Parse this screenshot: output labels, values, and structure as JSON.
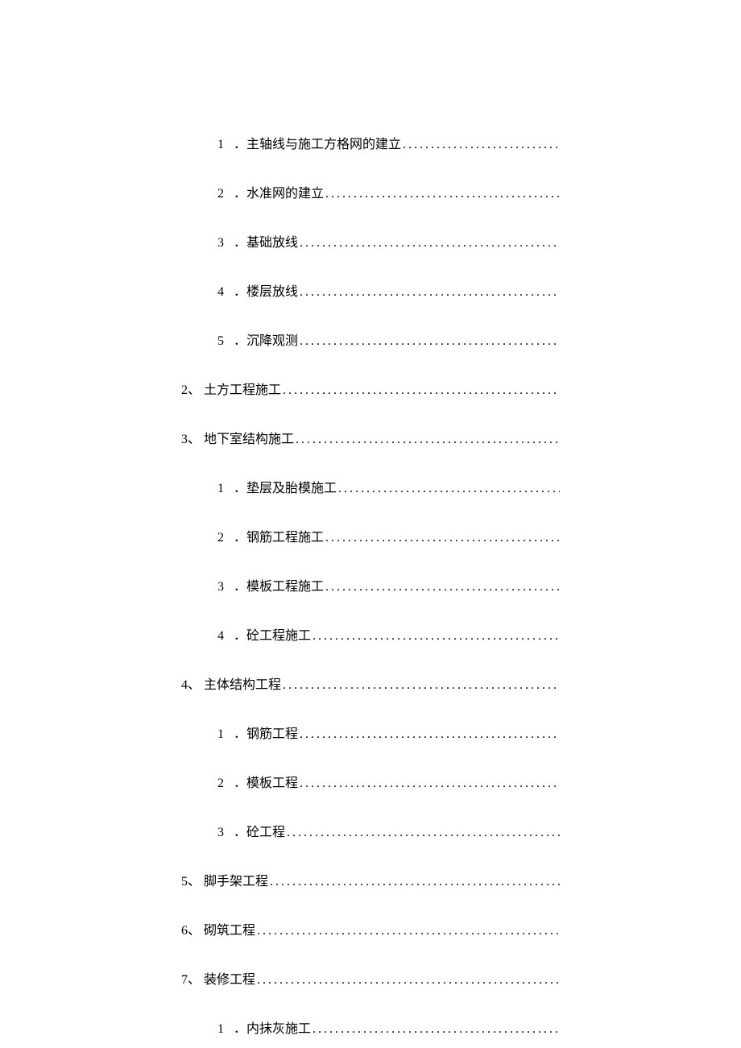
{
  "toc": [
    {
      "level": 2,
      "number": "1",
      "text": "．主轴线与施工方格网的建立"
    },
    {
      "level": 2,
      "number": "2",
      "text": "．水准网的建立 "
    },
    {
      "level": 2,
      "number": "3",
      "text": "．基础放线"
    },
    {
      "level": 2,
      "number": "4",
      "text": "．楼层放线 "
    },
    {
      "level": 2,
      "number": "5",
      "text": "．沉降观测"
    },
    {
      "level": 1,
      "number": "2、",
      "text": "土方工程施工 "
    },
    {
      "level": 1,
      "number": "3、",
      "text": "地下室结构施工 "
    },
    {
      "level": 2,
      "number": "1",
      "text": "．垫层及胎模施工"
    },
    {
      "level": 2,
      "number": "2",
      "text": "．钢筋工程施工 "
    },
    {
      "level": 2,
      "number": "3",
      "text": "．模板工程施工"
    },
    {
      "level": 2,
      "number": "4",
      "text": "．砼工程施工 "
    },
    {
      "level": 1,
      "number": "4、",
      "text": "主体结构工程 "
    },
    {
      "level": 2,
      "number": "1",
      "text": "．钢筋工程"
    },
    {
      "level": 2,
      "number": "2",
      "text": "．模板工程 "
    },
    {
      "level": 2,
      "number": "3",
      "text": "．砼工程"
    },
    {
      "level": 1,
      "number": "5、",
      "text": "脚手架工程 "
    },
    {
      "level": 1,
      "number": "6、",
      "text": "砌筑工程 "
    },
    {
      "level": 1,
      "number": "7、",
      "text": "装修工程 "
    },
    {
      "level": 2,
      "number": "1",
      "text": "．内抹灰施工"
    }
  ]
}
